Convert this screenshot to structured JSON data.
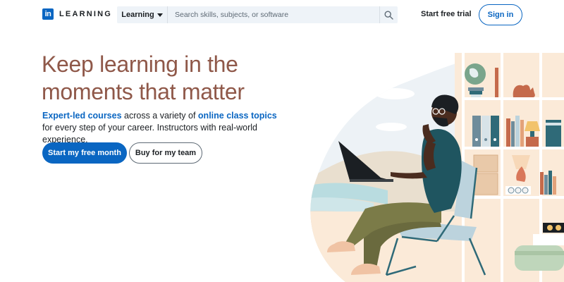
{
  "header": {
    "logo_letters": "in",
    "logo_text": "LEARNING",
    "search": {
      "scope_label": "Learning",
      "placeholder": "Search skills, subjects, or software"
    },
    "trial_link": "Start free trial",
    "signin_label": "Sign in"
  },
  "hero": {
    "title_line1": "Keep learning in the",
    "title_line2": "moments that matter",
    "subtitle_link1": "Expert-led courses",
    "subtitle_text1": " across a variety of ",
    "subtitle_link2": "online class topics",
    "subtitle_text2": " for every step of your career. Instructors with real-world experience.",
    "primary_cta": "Start my free month",
    "secondary_cta": "Buy for my team"
  },
  "colors": {
    "brand_blue": "#0a66c2",
    "title_brown": "#8f5849",
    "search_bg": "#eef3f8"
  },
  "icons": {
    "search": "search-icon",
    "scope_caret": "caret-down-icon"
  }
}
